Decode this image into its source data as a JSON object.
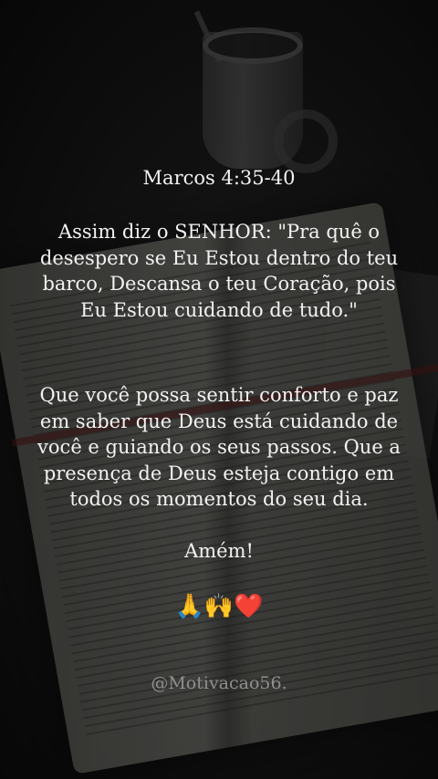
{
  "reference": "Marcos 4:35-40",
  "paragraph1": "Assim diz o SENHOR: \"Pra quê o desespero se Eu Estou dentro do teu barco, Descansa o teu Coração, pois Eu Estou cuidando de tudo.\"",
  "paragraph2": "Que você possa sentir conforto e paz em saber que Deus está cuidando de você e guiando os seus passos. Que a presença de Deus esteja contigo em todos os momentos do seu dia.",
  "closing": "Amém!",
  "emojis": "🙏🙌❤️",
  "handle": "@Motivacao56."
}
